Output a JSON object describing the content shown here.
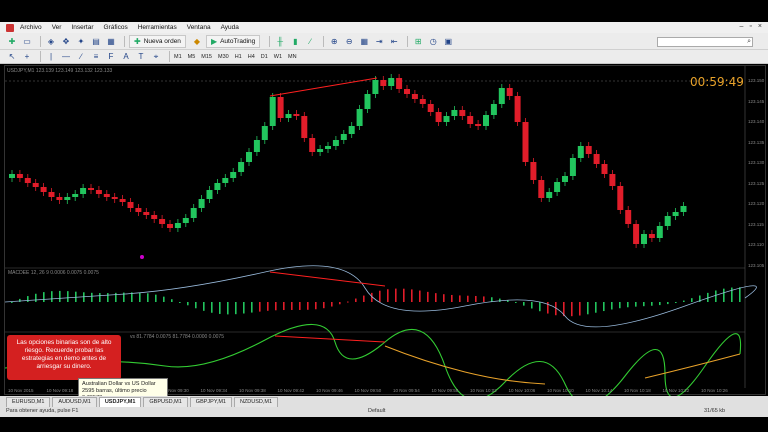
{
  "menu": {
    "items": [
      "Archivo",
      "Ver",
      "Insertar",
      "Gráficos",
      "Herramientas",
      "Ventana",
      "Ayuda"
    ]
  },
  "toolbar": {
    "new_order_label": "Nueva orden",
    "autotrading_label": "AutoTrading",
    "timeframes": [
      "M1",
      "M5",
      "M15",
      "M30",
      "H1",
      "H4",
      "D1",
      "W1",
      "MN"
    ]
  },
  "chart": {
    "symbol_label": "USDJPY,M1  123.139 123.149 123.132 123.133",
    "timer": "00:59:49",
    "indicator1_label": "MACDEE 12, 26 9 0.0006 0.0075 0.0075",
    "indicator2_label": "vs 81.7784 0.0075 81.7784 0.0000 0.0075",
    "price_ticks": [
      "123.150",
      "123.145",
      "123.140",
      "123.135",
      "123.130",
      "123.125",
      "123.120",
      "123.115",
      "123.110",
      "123.105"
    ],
    "time_ticks": [
      "10 Nov 2015",
      "10 Nov 09:18",
      "10 Nov 09:22",
      "10 Nov 09:26",
      "10 Nov 09:30",
      "10 Nov 09:34",
      "10 Nov 09:38",
      "10 Nov 09:42",
      "10 Nov 09:46",
      "10 Nov 09:50",
      "10 Nov 09:54",
      "10 Nov 09:58",
      "10 Nov 10:02",
      "10 Nov 10:06",
      "10 Nov 10:10",
      "10 Nov 10:14",
      "10 Nov 10:18",
      "10 Nov 10:22",
      "10 Nov 10:26"
    ]
  },
  "warning": {
    "text": "Las opciones binarias son de alto riesgo. Recuerde probar las estrategias en demo antes de arriesgar su dinero."
  },
  "tooltip": {
    "line1": "Australian Dollar vs US Dollar",
    "line2": "2595 barras, último precio 0.70573"
  },
  "tabs": [
    "EURUSD,M1",
    "AUDUSD,M1",
    "USDJPY,M1",
    "GBPUSD,M1",
    "GBPJPY,M1",
    "NZDUSD,M1"
  ],
  "status": {
    "left": "Para obtener ayuda, pulse F1",
    "middle": "Default",
    "right": "31/65 kb"
  },
  "colors": {
    "bull": "#22c55e",
    "bear": "#e11d2a",
    "timer": "#e8a22a",
    "divergence": "#ff2020",
    "warning_bg": "#d42020"
  }
}
